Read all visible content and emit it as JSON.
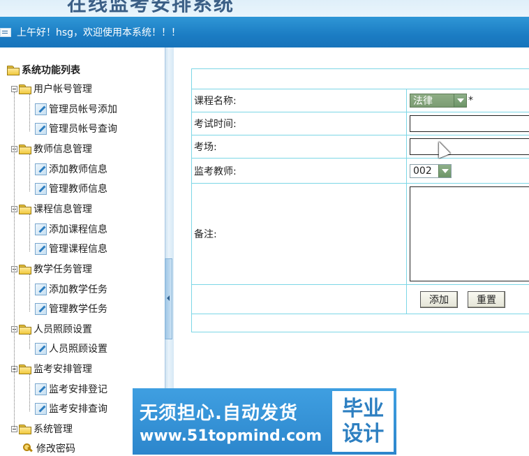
{
  "header": {
    "system_title": "在线监考安排系统",
    "greeting": "上午好！hsg，欢迎使用本系统！！！"
  },
  "sidebar": {
    "root_label": "系统功能列表",
    "groups": [
      {
        "label": "用户帐号管理",
        "items": [
          "管理员帐号添加",
          "管理员帐号查询"
        ]
      },
      {
        "label": "教师信息管理",
        "items": [
          "添加教师信息",
          "管理教师信息"
        ]
      },
      {
        "label": "课程信息管理",
        "items": [
          "添加课程信息",
          "管理课程信息"
        ]
      },
      {
        "label": "教学任务管理",
        "items": [
          "添加教学任务",
          "管理教学任务"
        ]
      },
      {
        "label": "人员照顾设置",
        "items": [
          "人员照顾设置"
        ]
      },
      {
        "label": "监考安排管理",
        "items": [
          "监考安排登记",
          "监考安排查询"
        ]
      },
      {
        "label": "系统管理",
        "items": [
          "修改密码"
        ]
      }
    ]
  },
  "form": {
    "course_label": "课程名称:",
    "course_value": "法律",
    "required_mark": "*",
    "exam_time_label": "考试时间:",
    "exam_time_value": "",
    "exam_room_label": "考场:",
    "exam_room_value": "",
    "proctor_label": "监考教师:",
    "proctor_value": "002",
    "remark_label": "备注:",
    "remark_value": "",
    "add_button": "添加",
    "reset_button": "重置"
  },
  "watermark": {
    "line1": "无须担心.自动发货",
    "line2": "www.51topmind.com",
    "badge_line1": "毕业",
    "badge_line2": "设计"
  },
  "icons": {
    "folder": "folder-open-icon",
    "leaf": "page-edit-icon",
    "key": "key-icon"
  }
}
